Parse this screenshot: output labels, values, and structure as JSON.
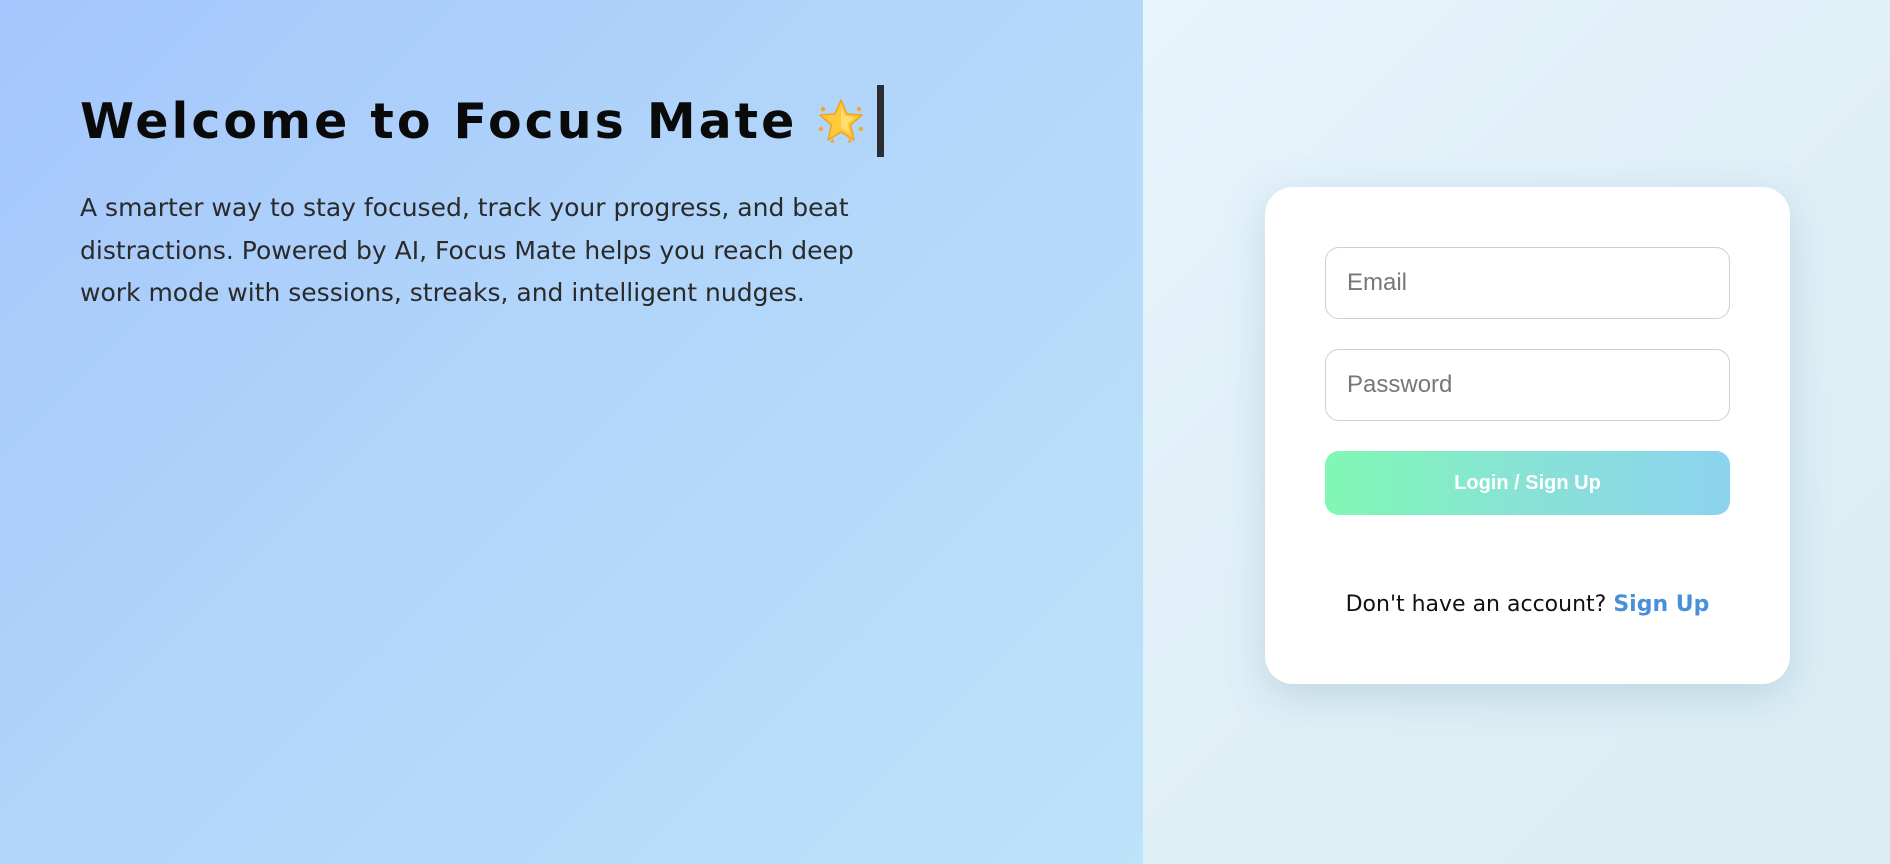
{
  "hero": {
    "title": "Welcome to Focus Mate",
    "title_icon": "glowing-star-icon",
    "description": "A smarter way to stay focused, track your progress, and beat distractions. Powered by AI, Focus Mate helps you reach deep work mode with sessions, streaks, and intelligent nudges."
  },
  "login": {
    "email_placeholder": "Email",
    "password_placeholder": "Password",
    "submit_label": "Login / Sign Up",
    "signup_prompt": "Don't have an account?",
    "signup_link": "Sign Up"
  },
  "colors": {
    "left_gradient": [
      "#a4c6fc",
      "#bde3f9"
    ],
    "button_gradient": [
      "#80f8b4",
      "#8cd3ef"
    ],
    "link": "#4a90d9"
  }
}
